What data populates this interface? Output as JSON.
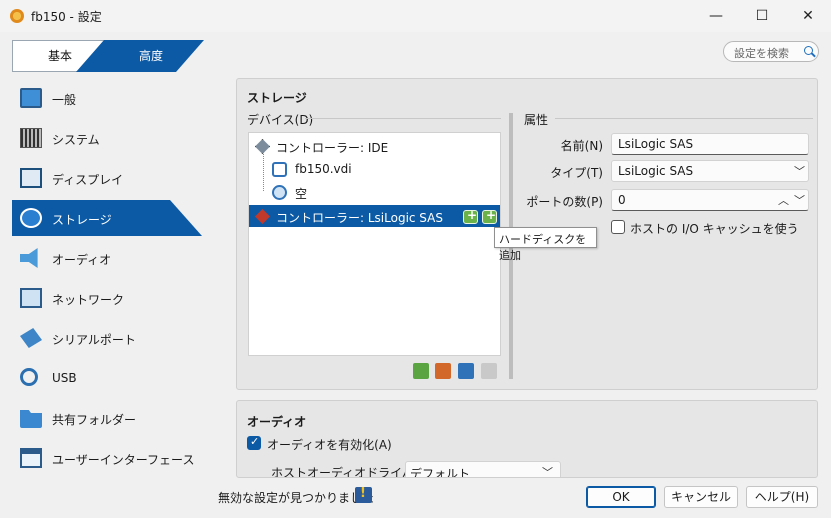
{
  "window": {
    "title": "fb150 - 設定",
    "minimize_icon": "—",
    "maximize_icon": "☐",
    "close_icon": "✕"
  },
  "mode_tabs": {
    "basic": "基本",
    "advanced": "高度",
    "active": "advanced"
  },
  "search": {
    "placeholder": "設定を検索"
  },
  "sidebar": {
    "items": [
      {
        "label": "一般",
        "icon": "monitor-icon"
      },
      {
        "label": "システム",
        "icon": "chip-icon"
      },
      {
        "label": "ディスプレイ",
        "icon": "display-icon"
      },
      {
        "label": "ストレージ",
        "icon": "storage-disk-icon",
        "active": true
      },
      {
        "label": "オーディオ",
        "icon": "speaker-icon"
      },
      {
        "label": "ネットワーク",
        "icon": "network-icon"
      },
      {
        "label": "シリアルポート",
        "icon": "serial-port-icon"
      },
      {
        "label": "USB",
        "icon": "usb-icon"
      },
      {
        "label": "共有フォルダー",
        "icon": "folder-icon"
      },
      {
        "label": "ユーザーインターフェース",
        "icon": "user-interface-icon"
      }
    ]
  },
  "storage": {
    "title": "ストレージ",
    "devices_label": "デバイス(D)",
    "tree": [
      {
        "label": "コントローラー: IDE",
        "type": "controller-ide"
      },
      {
        "label": "fb150.vdi",
        "type": "hard-disk"
      },
      {
        "label": "空",
        "type": "optical-disk"
      },
      {
        "label": "コントローラー: LsiLogic SAS",
        "type": "controller-sas",
        "selected": true
      }
    ],
    "tooltip": "ハードディスクを追加",
    "attributes_label": "属性",
    "name_label": "名前(N)",
    "name_value": "LsiLogic SAS",
    "type_label": "タイプ(T)",
    "type_value": "LsiLogic SAS",
    "ports_label": "ポートの数(P)",
    "ports_value": "0",
    "host_cache_label": "ホストの I/O キャッシュを使う",
    "host_cache_checked": false
  },
  "audio": {
    "title": "オーディオ",
    "enable_label": "オーディオを有効化(A)",
    "enable_checked": true,
    "driver_label": "ホストオーディオドライバー(D)",
    "driver_value": "デフォルト"
  },
  "footer": {
    "warning": "無効な設定が見つかりました",
    "ok": "OK",
    "cancel": "キャンセル",
    "help": "ヘルプ(H)"
  },
  "colors": {
    "accent": "#0c5aa6",
    "selection": "#0c5aa6",
    "panel": "#e6e6e6"
  }
}
